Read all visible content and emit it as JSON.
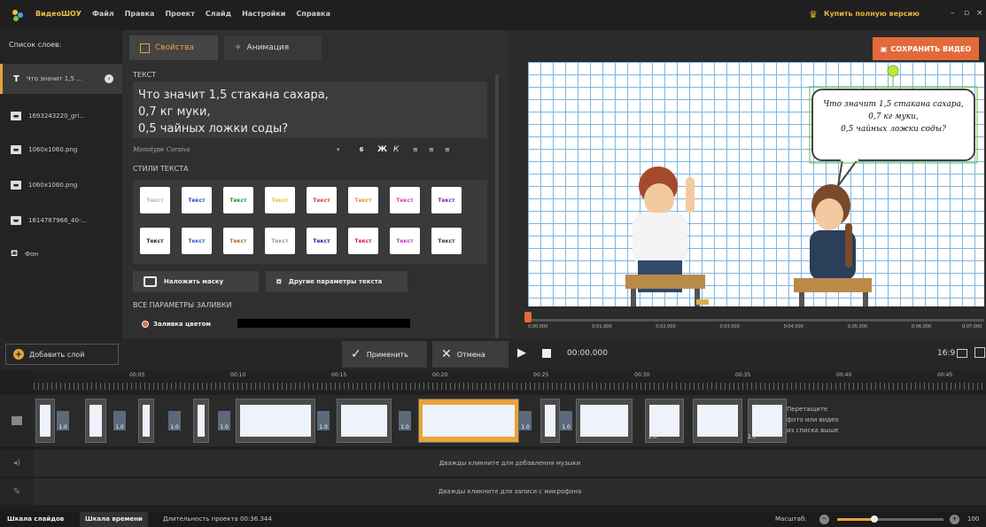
{
  "menu": [
    "ВидеоШОУ",
    "Файл",
    "Правка",
    "Проект",
    "Слайд",
    "Настройки",
    "Справка"
  ],
  "buy_full": "Купить полную версию",
  "window_controls": [
    "–",
    "▫",
    "×"
  ],
  "layers": {
    "header": "Список слоев:",
    "items": [
      {
        "label": "Что значит 1,5 ...",
        "icon": "T"
      },
      {
        "label": "1693243220_gri...",
        "icon": "image"
      },
      {
        "label": "1060x1060.png",
        "icon": "image"
      },
      {
        "label": "1060x1060.png",
        "icon": "image"
      },
      {
        "label": "1614787966_40-...",
        "icon": "image"
      },
      {
        "label": "Фон",
        "icon": "bucket"
      }
    ]
  },
  "props": {
    "tab_properties": "Свойства",
    "tab_animation": "Анимация",
    "text_label": "ТЕКСТ",
    "text_lines": [
      "Что значит 1,5 стакана сахара,",
      "0,7 кг муки,",
      "0,5 чайных ложки соды?"
    ],
    "font_name": "Monotype Corsiva",
    "font_size": "6",
    "format_buttons": [
      "Ж",
      "К"
    ],
    "styles_label": "СТИЛИ ТЕКСТА",
    "style_samples": [
      {
        "label": "Текст",
        "color": "#b5b5b5"
      },
      {
        "label": "Текст",
        "color": "#2a4fb5"
      },
      {
        "label": "Текст",
        "color": "#1f8f3a"
      },
      {
        "label": "Текст",
        "color": "#e5c63a"
      },
      {
        "label": "Текст",
        "color": "#d43a3a"
      },
      {
        "label": "Текст",
        "color": "#f08a2a"
      },
      {
        "label": "Текст",
        "color": "#d63ab5"
      },
      {
        "label": "Текст",
        "color": "#7a2a9a"
      },
      {
        "label": "Текст",
        "color": "#222222"
      },
      {
        "label": "Текст",
        "color": "#3a5ad4"
      },
      {
        "label": "Текст",
        "color": "#a86a2a"
      },
      {
        "label": "Текст",
        "color": "#999999"
      },
      {
        "label": "Текст",
        "color": "#1a2a8a"
      },
      {
        "label": "Текст",
        "color": "#c2185b"
      },
      {
        "label": "Текст",
        "color": "#c23ad4"
      },
      {
        "label": "Текст",
        "color": "#333333"
      }
    ],
    "mask_button": "Наложить маску",
    "more_text_button": "Другие параметры текста",
    "fill_label": "ВСЕ ПАРАМЕТРЫ ЗАЛИВКИ",
    "fill_color_option": "Заливка цветом"
  },
  "preview": {
    "save_button": "СОХРАНИТЬ ВИДЕО",
    "bubble_lines": [
      "Что значит 1,5 стакана сахара,",
      "0,7 кг муки,",
      "0,5 чайных ложки соды?"
    ],
    "ruler_ticks": [
      "0:00.000",
      "0:01.000",
      "0:02.000",
      "0:03.000",
      "0:04.000",
      "0:05.000",
      "0:06.000",
      "0:07.000"
    ]
  },
  "toolbar": {
    "add_layer": "Добавить слой",
    "apply": "Применить",
    "cancel": "Отмена",
    "time": "00:00.000",
    "aspect": "16:9"
  },
  "timeline": {
    "ticks": [
      "00:05",
      "00:10",
      "00:15",
      "00:20",
      "00:25",
      "00:30",
      "00:35",
      "00:40",
      "00:45"
    ],
    "durations": [
      "1.0",
      "1.0",
      "1.0",
      "1.0",
      "1.0",
      "1.0",
      "1.0",
      "1.0",
      "2.0",
      "2.0"
    ],
    "drop_hint": [
      "Перетащите",
      "фото или видео",
      "из списка выше"
    ],
    "music_hint": "Дважды кликните для добавления музыки",
    "mic_hint": "Дважды кликните для записи с микрофона"
  },
  "status": {
    "tab_slides": "Шкала слайдов",
    "tab_timeline": "Шкала времени",
    "duration": "Длительность проекта 00:36.344",
    "scale_label": "Масштаб:",
    "zoom": "100"
  },
  "colors": {
    "accent": "#e9a33a",
    "save": "#e26a3a",
    "grid": "#7fb6e0"
  }
}
